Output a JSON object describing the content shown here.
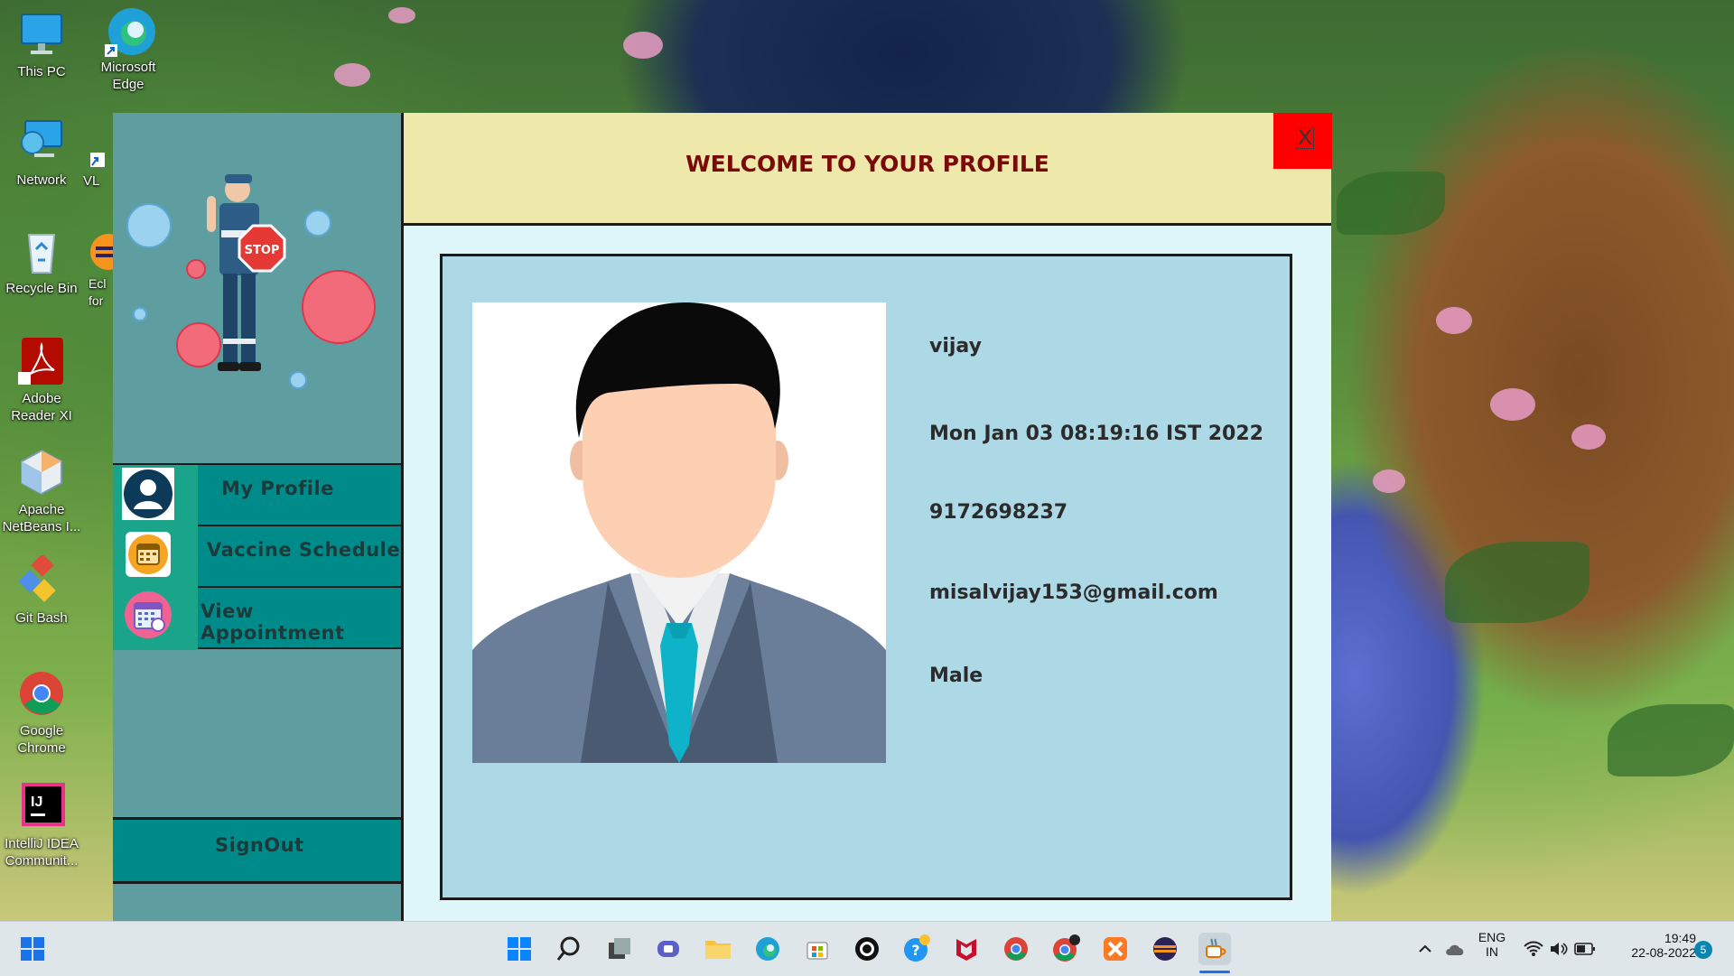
{
  "desktop": {
    "icons": [
      {
        "label": "This PC",
        "icon": "computer-icon"
      },
      {
        "label": "Microsoft Edge",
        "icon": "edge-icon"
      },
      {
        "label": "Network",
        "icon": "network-icon"
      },
      {
        "label": "VL",
        "icon": "vlc-icon"
      },
      {
        "label": "Recycle Bin",
        "icon": "recycle-bin-icon"
      },
      {
        "label": "Ecl for",
        "icon": "eclipse-icon"
      },
      {
        "label": "Adobe Reader XI",
        "icon": "adobe-reader-icon"
      },
      {
        "label": "Apache NetBeans I...",
        "icon": "netbeans-icon"
      },
      {
        "label": "Git Bash",
        "icon": "git-bash-icon"
      },
      {
        "label": "Google Chrome",
        "icon": "chrome-icon"
      },
      {
        "label": "IntelliJ IDEA Communit...",
        "icon": "intellij-icon"
      }
    ]
  },
  "app": {
    "header_title": "WELCOME TO YOUR PROFILE",
    "close_label": "X",
    "sidebar": {
      "nav": [
        {
          "label": "My Profile",
          "icon": "user-avatar-icon"
        },
        {
          "label": "Vaccine Schedule",
          "icon": "calendar-icon"
        },
        {
          "label": "View Appointment",
          "icon": "appointment-calendar-icon"
        }
      ],
      "signout_label": "SignOut"
    },
    "profile": {
      "name": "vijay",
      "date": "Mon Jan 03 08:19:16 IST 2022",
      "phone": "9172698237",
      "email": "misalvijay153@gmail.com",
      "gender": "Male"
    }
  },
  "taskbar": {
    "language_line1": "ENG",
    "language_line2": "IN",
    "time": "19:49",
    "date": "22-08-2022",
    "notification_count": "5",
    "pinned": [
      "start-icon",
      "search-icon",
      "task-view-icon",
      "chat-icon",
      "file-explorer-icon",
      "edge-icon",
      "store-icon",
      "github-icon",
      "help-icon",
      "mcafee-icon",
      "chrome-icon",
      "chrome-profile-icon",
      "xampp-icon",
      "eclipse-icon",
      "java-icon"
    ]
  },
  "colors": {
    "sidebar": "#5f9ea0",
    "nav_item": "#008b8b",
    "header": "#eee8aa",
    "title_text": "#7a0a0a",
    "panel": "#add8e6",
    "close": "#ff0000"
  }
}
